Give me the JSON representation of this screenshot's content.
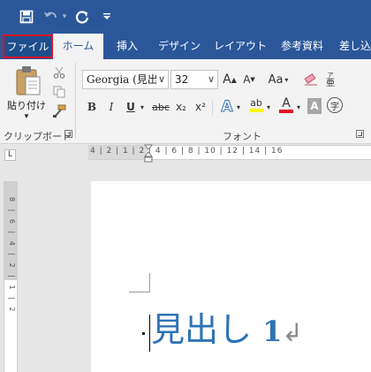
{
  "qat": {
    "save_icon": "save-icon",
    "undo_icon": "undo-icon",
    "redo_icon": "repeat-icon",
    "customize_icon": "customize-qat-icon"
  },
  "tabs": [
    "ファイル",
    "ホーム",
    "挿入",
    "デザイン",
    "レイアウト",
    "参考資料",
    "差し込"
  ],
  "clipboard": {
    "paste_label": "貼り付け",
    "group_label": "クリップボード"
  },
  "font": {
    "name": "Georgia (見出",
    "size": "32",
    "grow": "A",
    "shrink": "A",
    "change_case": "Aa",
    "bold": "B",
    "italic": "I",
    "underline": "U",
    "strike": "abc",
    "subscript": "x₂",
    "superscript": "x²",
    "text_effect": "A",
    "highlight": "ab",
    "font_color": "A",
    "char_shading": "A",
    "enclose": "字",
    "phonetic": "亜",
    "group_label": "フォント"
  },
  "ruler": {
    "tab_selector": "L",
    "h_marks": "4 | 2 | 1 | 2 | 4 | 6 | 8 | 10 | 12 | 14 | 16",
    "v_marks": "8 | 6 | 4 | 2 | 1 | 2"
  },
  "document": {
    "heading_text": "見出し ",
    "heading_num": "1",
    "paragraph_mark": "↲"
  },
  "colors": {
    "brand": "#2b579a",
    "heading": "#2e74b5",
    "highlight": "#ffff00",
    "font_color": "#e81123"
  }
}
